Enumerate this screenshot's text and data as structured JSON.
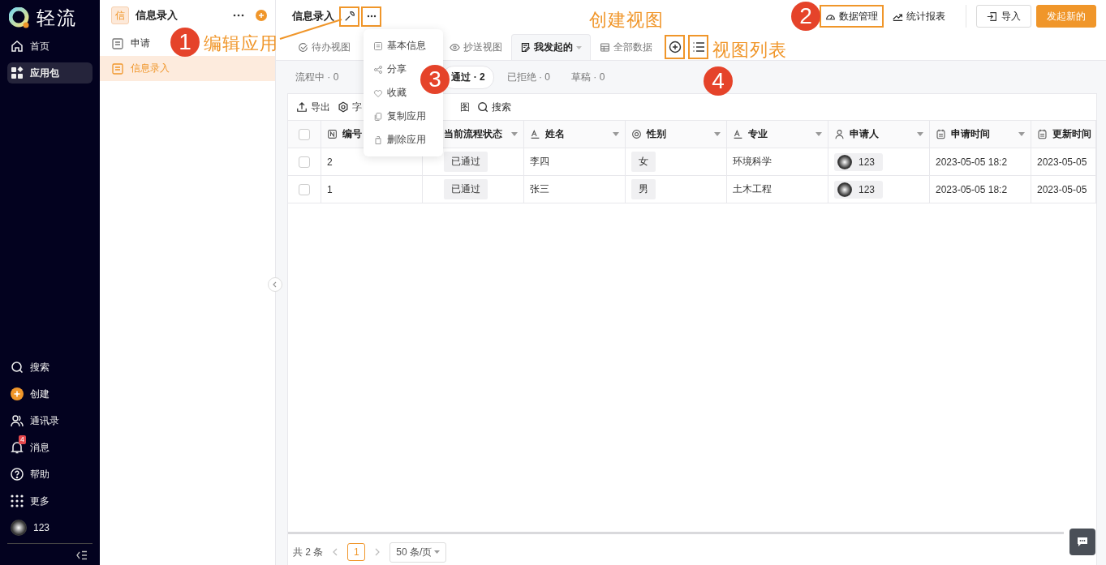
{
  "nav": {
    "logo": "轻流",
    "items": [
      {
        "label": "首页",
        "selected": false
      },
      {
        "label": "应用包",
        "selected": true
      }
    ],
    "bottom_items": [
      {
        "label": "搜索"
      },
      {
        "label": "创建"
      },
      {
        "label": "通讯录"
      },
      {
        "label": "消息",
        "badge": "4"
      },
      {
        "label": "帮助"
      },
      {
        "label": "更多"
      }
    ],
    "user": "123"
  },
  "app_panel": {
    "badge": "信",
    "title": "信息录入",
    "items": [
      {
        "label": "申请",
        "selected": false
      },
      {
        "label": "信息录入",
        "selected": true
      }
    ]
  },
  "header": {
    "title": "信息录入",
    "edit_highlighted": true,
    "more_highlighted": true,
    "buttons": [
      {
        "label": "数据管理",
        "highlighted": true
      },
      {
        "label": "统计报表",
        "highlighted": false
      }
    ],
    "import": "导入",
    "primary": "发起新的"
  },
  "more_menu": [
    "基本信息",
    "分享",
    "收藏",
    "复制应用",
    "删除应用"
  ],
  "view_tabs": [
    {
      "label": "待办视图",
      "selected": false
    },
    {
      "label": "抄送视图",
      "selected": false
    },
    {
      "label": "我发起的",
      "selected": true
    },
    {
      "label": "全部数据",
      "selected": false
    }
  ],
  "add_view_highlighted": true,
  "view_list_highlighted": true,
  "status_filters": [
    {
      "label": "流程中 · 0",
      "selected": false
    },
    {
      "label": "通过 · 2",
      "selected": true
    },
    {
      "label": "已拒绝 · 0",
      "selected": false
    },
    {
      "label": "草稿 · 0",
      "selected": false
    }
  ],
  "toolbar": [
    "导出",
    "字",
    "图",
    "搜索"
  ],
  "table": {
    "select_all_checked": false,
    "columns": [
      "编号",
      "当前流程状态",
      "姓名",
      "性别",
      "专业",
      "申请人",
      "申请时间",
      "更新时间"
    ],
    "rows": [
      {
        "checked": false,
        "cells": [
          "2",
          "已通过",
          "李四",
          "女",
          "环境科学",
          "123",
          "2023-05-05 18:2",
          "2023-05-05"
        ]
      },
      {
        "checked": false,
        "cells": [
          "1",
          "已通过",
          "张三",
          "男",
          "土木工程",
          "123",
          "2023-05-05 18:2",
          "2023-05-05"
        ]
      }
    ]
  },
  "pagination": {
    "total": "共 2 条",
    "pages": [
      {
        "label": "1",
        "selected": true
      }
    ],
    "page_size": "50 条/页"
  },
  "annotations": [
    {
      "number": "1",
      "label": "编辑应用"
    },
    {
      "number": "2"
    },
    {
      "number": "3"
    },
    {
      "number": "4"
    },
    {
      "label": "创建视图"
    },
    {
      "label": "视图列表"
    }
  ]
}
